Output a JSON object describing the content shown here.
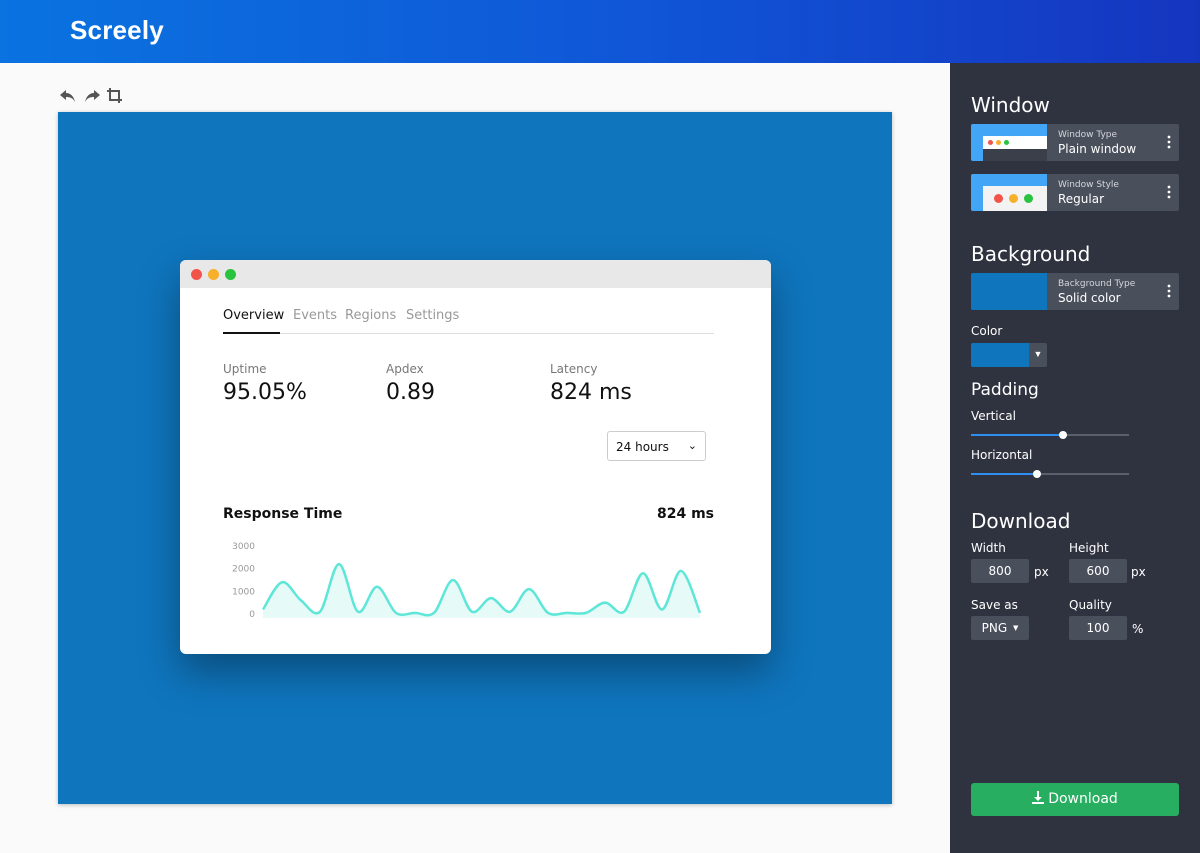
{
  "app": {
    "brand": "Screely"
  },
  "toolbar": {
    "undo_icon": "undo-icon",
    "redo_icon": "redo-icon",
    "crop_icon": "crop-icon"
  },
  "canvas": {
    "background_color": "#0f75bd"
  },
  "preview": {
    "tabs": [
      "Overview",
      "Events",
      "Regions",
      "Settings"
    ],
    "active_tab": "Overview",
    "stats": [
      {
        "label": "Uptime",
        "value": "95.05%"
      },
      {
        "label": "Apdex",
        "value": "0.89"
      },
      {
        "label": "Latency",
        "value": "824 ms"
      }
    ],
    "range_select": "24 hours",
    "response_title": "Response Time",
    "response_value": "824 ms",
    "chart_data": {
      "type": "area",
      "y_ticks": [
        "3000",
        "2000",
        "1000",
        "0"
      ],
      "ylim": [
        0,
        3000
      ],
      "values": [
        200,
        1400,
        600,
        100,
        2200,
        100,
        1200,
        50,
        50,
        50,
        1500,
        100,
        700,
        100,
        1100,
        50,
        50,
        50,
        500,
        100,
        1800,
        200,
        1900,
        50
      ],
      "line_color": "#5ee6d8",
      "fill_color": "#e6faf7"
    }
  },
  "panel": {
    "window_title": "Window",
    "window_type_sub": "Window Type",
    "window_type_value": "Plain window",
    "window_style_sub": "Window Style",
    "window_style_value": "Regular",
    "background_title": "Background",
    "background_type_sub": "Background Type",
    "background_type_value": "Solid color",
    "color_label": "Color",
    "color_value": "#0f75bd",
    "padding_title": "Padding",
    "vertical_label": "Vertical",
    "vertical_level": 0.58,
    "horizontal_label": "Horizontal",
    "horizontal_level": 0.42,
    "download_title": "Download",
    "width_label": "Width",
    "width_value": "800",
    "height_label": "Height",
    "height_value": "600",
    "px": "px",
    "save_as_label": "Save as",
    "save_as_value": "PNG",
    "quality_label": "Quality",
    "quality_value": "100",
    "percent": "%",
    "download_button": "Download",
    "download_color": "#27ae60"
  }
}
